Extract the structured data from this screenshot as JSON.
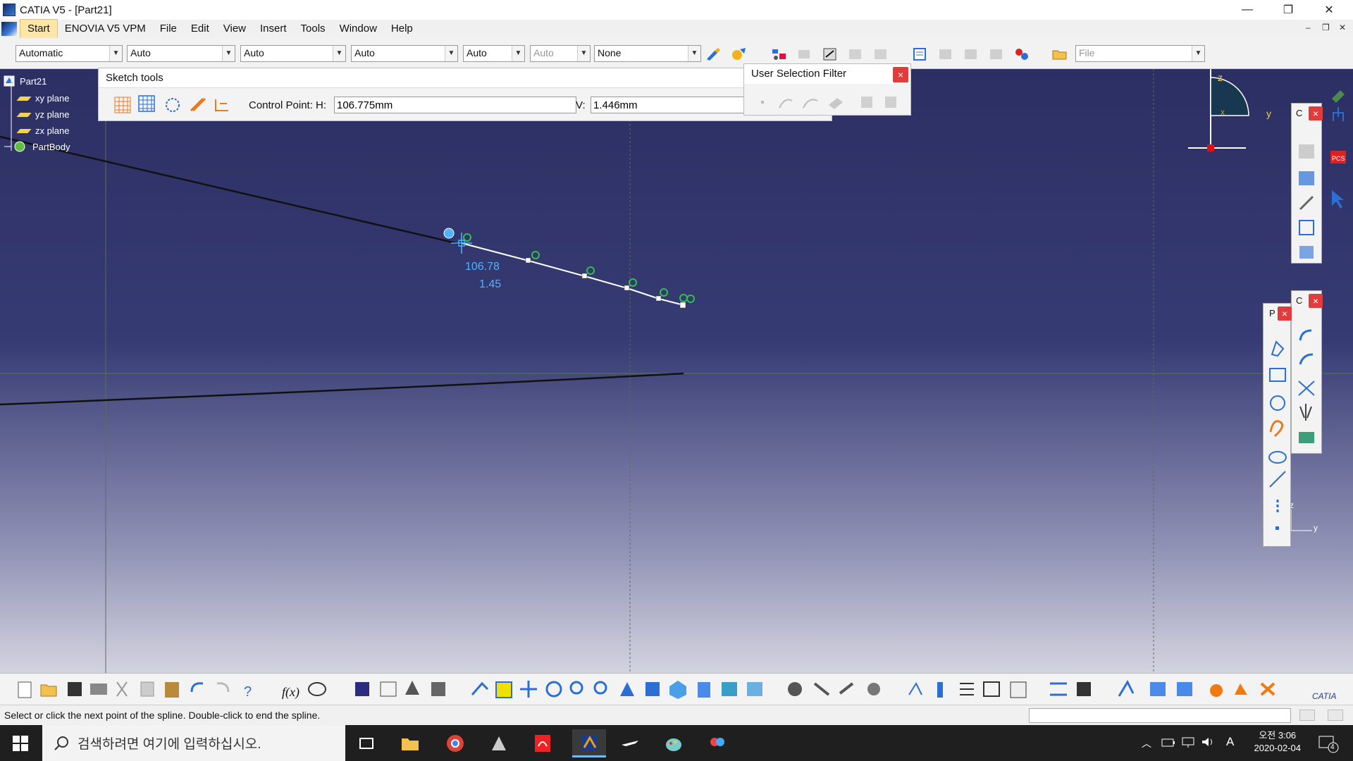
{
  "window": {
    "title": "CATIA V5 - [Part21]",
    "minimize": "—",
    "restore": "❐",
    "close": "✕"
  },
  "menu": {
    "items": [
      "Start",
      "ENOVIA V5 VPM",
      "File",
      "Edit",
      "View",
      "Insert",
      "Tools",
      "Window",
      "Help"
    ],
    "mdi_min": "–",
    "mdi_restore": "❐",
    "mdi_close": "✕"
  },
  "toolbar": {
    "combos": [
      "Automatic",
      "Auto",
      "Auto",
      "Auto",
      "Auto",
      "Auto",
      "None"
    ],
    "file_combo": "File"
  },
  "tree": {
    "root": "Part21",
    "items": [
      "xy plane",
      "yz plane",
      "zx plane"
    ],
    "body": "PartBody"
  },
  "sketch_tools": {
    "title": "Sketch tools",
    "h_label": "Control Point: H:",
    "h_value": "106.775mm",
    "v_label": "V:",
    "v_value": "1.446mm"
  },
  "selection_filter": {
    "title": "User Selection Filter",
    "close": "×"
  },
  "viewport": {
    "coord_h": "106.78",
    "coord_v": "1.45",
    "compass_z": "z",
    "compass_y": "y",
    "compass_x": "x",
    "axis_z": "z",
    "axis_y": "y"
  },
  "palettes": {
    "p1_title": "C",
    "p2_title": "C",
    "p3_title": "P",
    "close": "×"
  },
  "status": {
    "message": "Select or click the next point of the spline. Double-click to end the spline."
  },
  "taskbar": {
    "search_placeholder": "검색하려면 여기에 입력하십시오.",
    "time": "오전 3:06",
    "date": "2020-02-04",
    "ime": "A",
    "notifications": "4"
  },
  "colors": {
    "viewport_top": "#2c2f63",
    "spline": "#ffffff",
    "control_point": "#2fbf4a",
    "coord_text": "#4fb3ff",
    "palette_close": "#e23b3b"
  }
}
